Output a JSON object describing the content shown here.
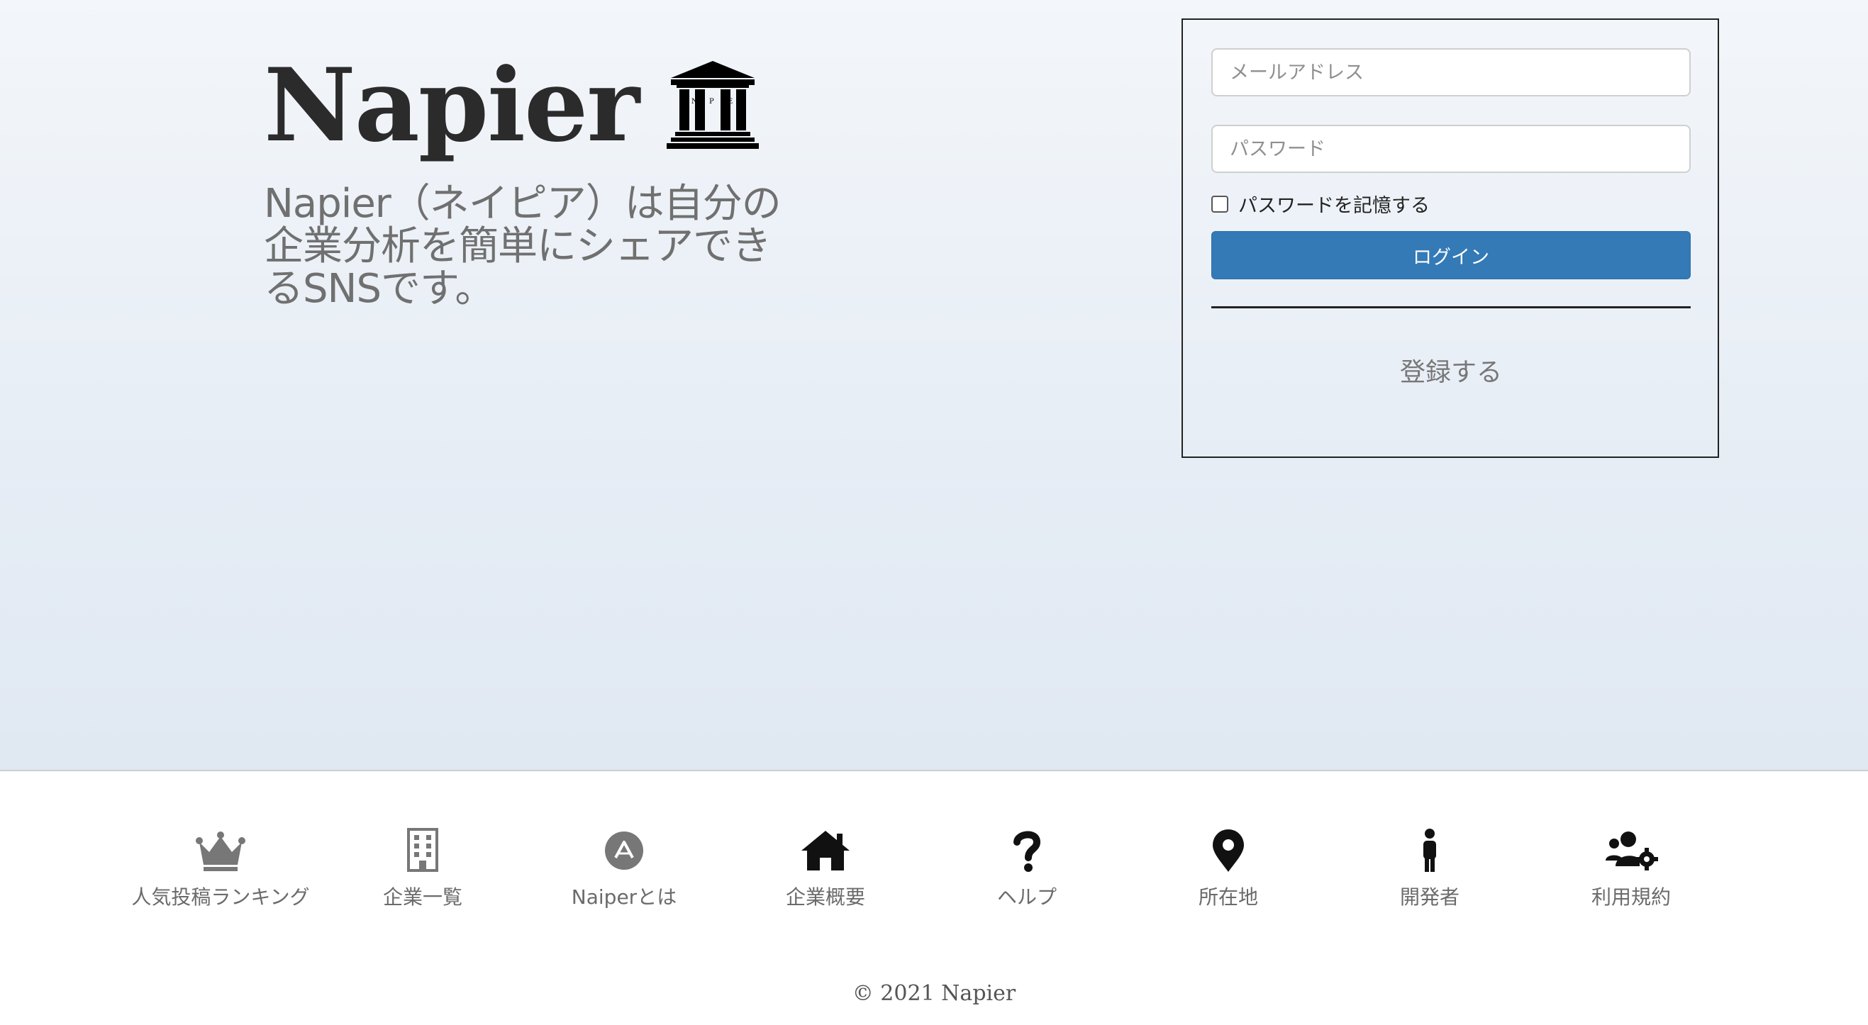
{
  "brand": {
    "title": "Napier",
    "logo_icon": "columns-building-icon",
    "logo_letters": [
      "N",
      "P",
      "E"
    ]
  },
  "tagline": "Napier（ネイピア）は自分の企業分析を簡単にシェアできるSNSです。",
  "login": {
    "email_placeholder": "メールアドレス",
    "password_placeholder": "パスワード",
    "remember_label": "パスワードを記憶する",
    "remember_checked": false,
    "login_label": "ログイン",
    "register_label": "登録する",
    "button_color": "#337ab7"
  },
  "footer_nav": [
    {
      "label": "人気投稿ランキング",
      "icon": "crown-icon"
    },
    {
      "label": "企業一覧",
      "icon": "building-icon"
    },
    {
      "label": "Naiperとは",
      "icon": "circle-a-icon"
    },
    {
      "label": "企業概要",
      "icon": "home-icon"
    },
    {
      "label": "ヘルプ",
      "icon": "question-icon"
    },
    {
      "label": "所在地",
      "icon": "map-pin-icon"
    },
    {
      "label": "開発者",
      "icon": "person-icon"
    },
    {
      "label": "利用規約",
      "icon": "users-gear-icon"
    }
  ],
  "copyright": "© 2021 Napier"
}
